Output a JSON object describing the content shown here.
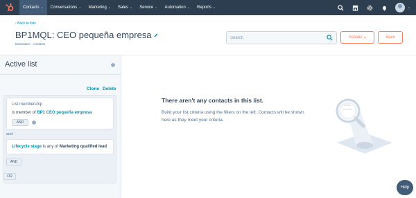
{
  "nav": {
    "items": [
      {
        "label": "Contacts",
        "active": true
      },
      {
        "label": "Conversations",
        "active": false
      },
      {
        "label": "Marketing",
        "active": false
      },
      {
        "label": "Sales",
        "active": false
      },
      {
        "label": "Service",
        "active": false
      },
      {
        "label": "Automation",
        "active": false
      },
      {
        "label": "Reports",
        "active": false
      }
    ],
    "right_icons": [
      "search-icon",
      "marketplace-icon",
      "settings-icon",
      "notifications-icon"
    ],
    "bg_color": "#2d3e50",
    "logo_color": "#ff7a59"
  },
  "header": {
    "back_label": "Back to lists",
    "title": "BP1MQL: CEO pequeña empresa",
    "estimation": "Estimation: - contacts",
    "search_placeholder": "Search",
    "actions_label": "Actions",
    "save_label": "Save",
    "accent_color": "#ff7a59"
  },
  "left_panel": {
    "title": "Active list",
    "clone_label": "Clone",
    "delete_label": "Delete",
    "filter1": {
      "heading": "List membership",
      "prefix": "is member of ",
      "list_name": "BP1 CEO pequeña empresa",
      "and_label": "AND"
    },
    "connector": "and",
    "filter2": {
      "property": "Lifecycle stage",
      "operator": " is any of ",
      "value": "Marketing qualified lead"
    },
    "and_label": "AND",
    "or_label": "OR"
  },
  "empty_state": {
    "title": "There aren't any contacts in this list.",
    "description": "Build your list criteria using the filters on the left. Contacts will be shown here as they meet your criteria."
  },
  "help": {
    "label": "Help"
  }
}
